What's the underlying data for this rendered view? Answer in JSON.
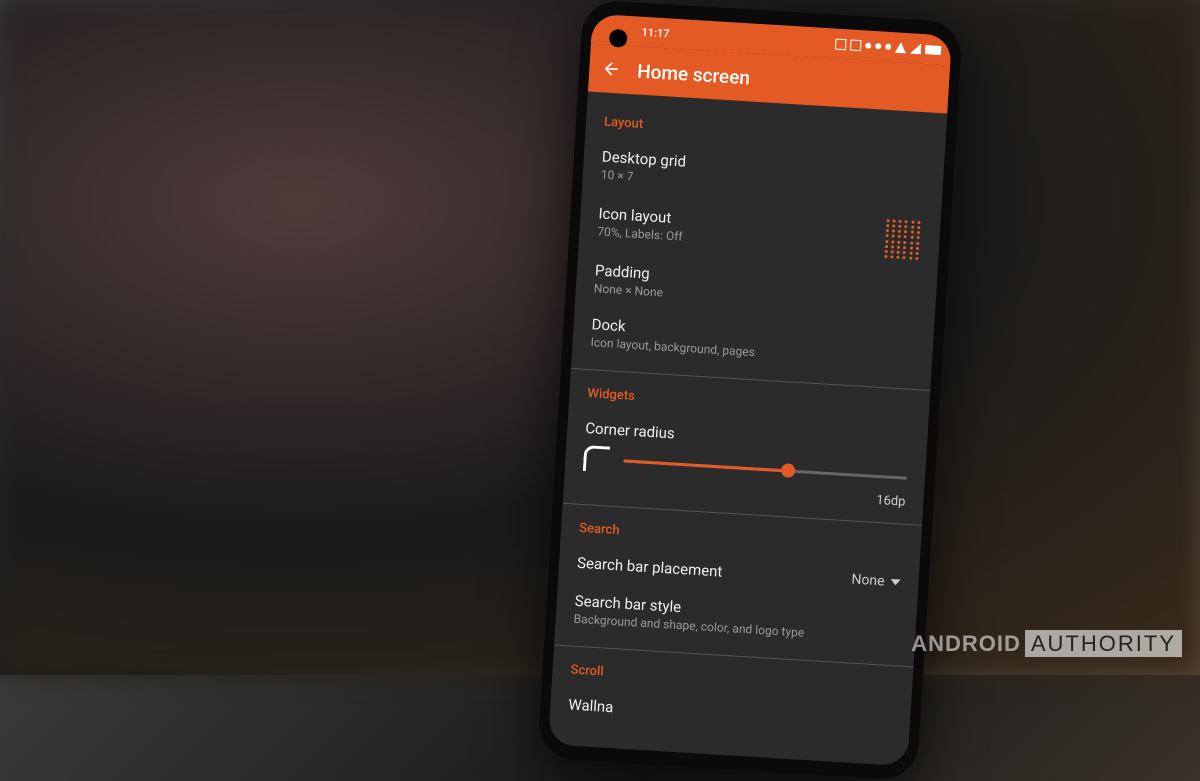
{
  "status": {
    "time": "11:17"
  },
  "appbar": {
    "title": "Home screen"
  },
  "sections": {
    "layout": {
      "header": "Layout",
      "desktop_grid": {
        "title": "Desktop grid",
        "sub": "10 × 7"
      },
      "icon_layout": {
        "title": "Icon layout",
        "sub": "70%, Labels: Off"
      },
      "padding": {
        "title": "Padding",
        "sub": "None × None"
      },
      "dock": {
        "title": "Dock",
        "sub": "Icon layout, background, pages"
      }
    },
    "widgets": {
      "header": "Widgets",
      "corner_radius": {
        "title": "Corner radius",
        "value": "16dp"
      }
    },
    "search": {
      "header": "Search",
      "placement": {
        "title": "Search bar placement",
        "value": "None"
      },
      "style": {
        "title": "Search bar style",
        "sub": "Background and shape, color, and logo type"
      }
    },
    "scroll": {
      "header": "Scroll",
      "wallpaper": {
        "title": "Wallna"
      }
    }
  },
  "watermark": {
    "brand1": "ANDROID",
    "brand2": "AUTHORITY"
  }
}
